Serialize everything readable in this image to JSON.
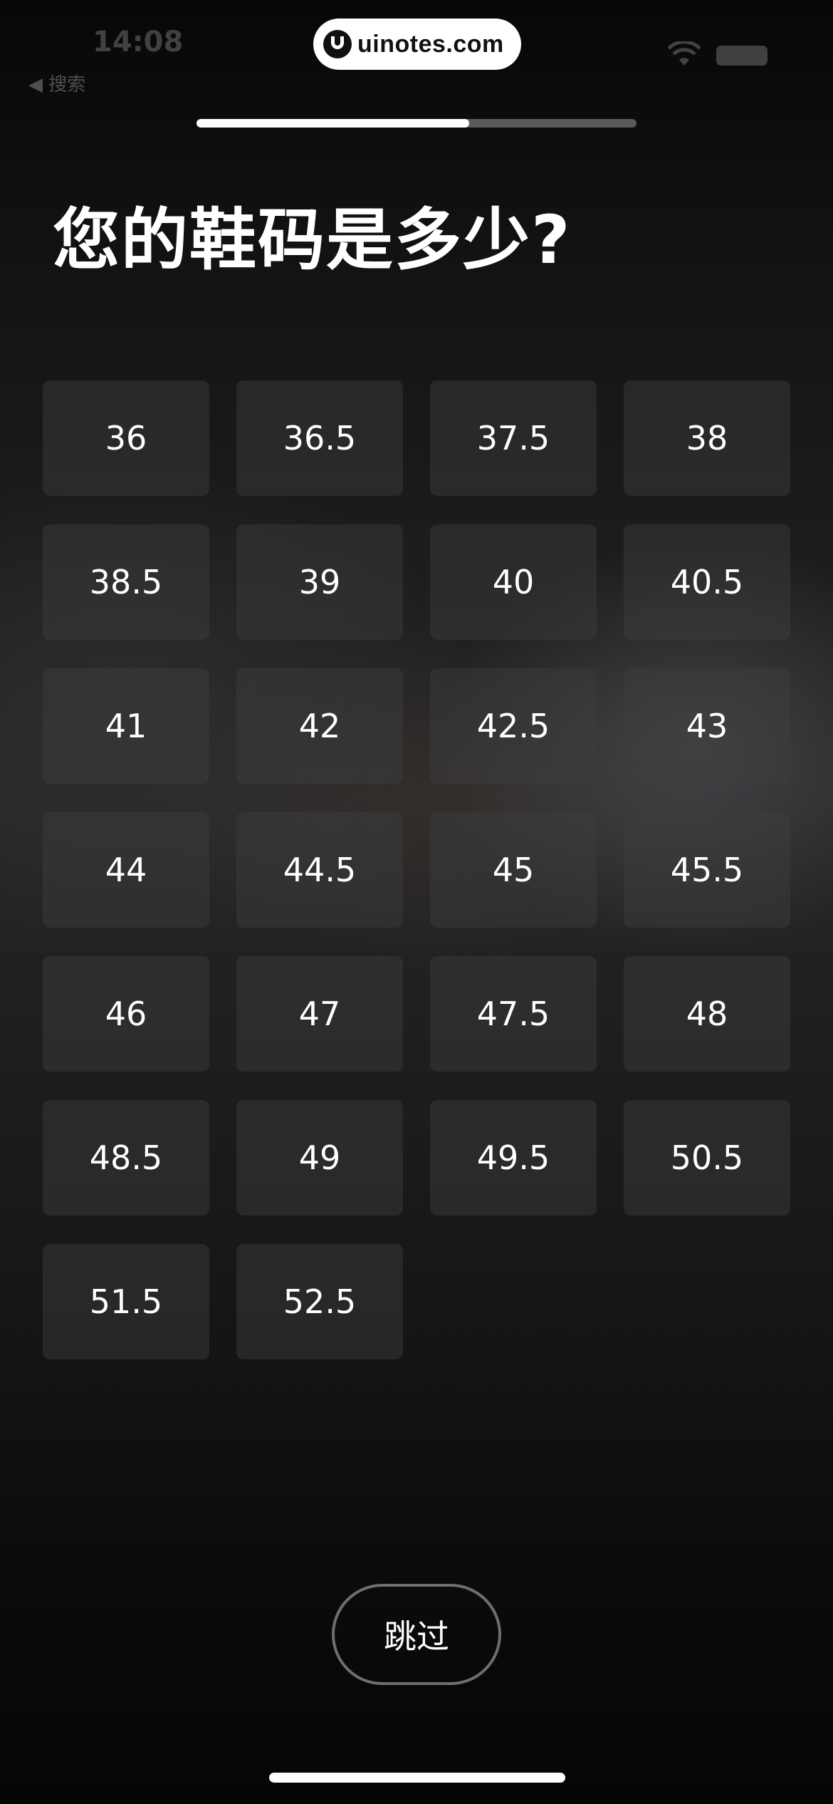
{
  "status_bar": {
    "time": "14:08",
    "back_app": "◀ 搜索"
  },
  "watermark": {
    "text": "uinotes.com"
  },
  "progress": {
    "value": 0.62
  },
  "question": {
    "title": "您的鞋码是多少?"
  },
  "sizes": [
    "36",
    "36.5",
    "37.5",
    "38",
    "38.5",
    "39",
    "40",
    "40.5",
    "41",
    "42",
    "42.5",
    "43",
    "44",
    "44.5",
    "45",
    "45.5",
    "46",
    "47",
    "47.5",
    "48",
    "48.5",
    "49",
    "49.5",
    "50.5",
    "51.5",
    "52.5"
  ],
  "footer": {
    "skip_label": "跳过"
  },
  "colors": {
    "background": "#1c1c1c",
    "option_background": "#2a2a2a",
    "progress_fill": "#ffffff",
    "progress_track": "#5a5a5a",
    "skip_border": "#6e6e6e"
  }
}
